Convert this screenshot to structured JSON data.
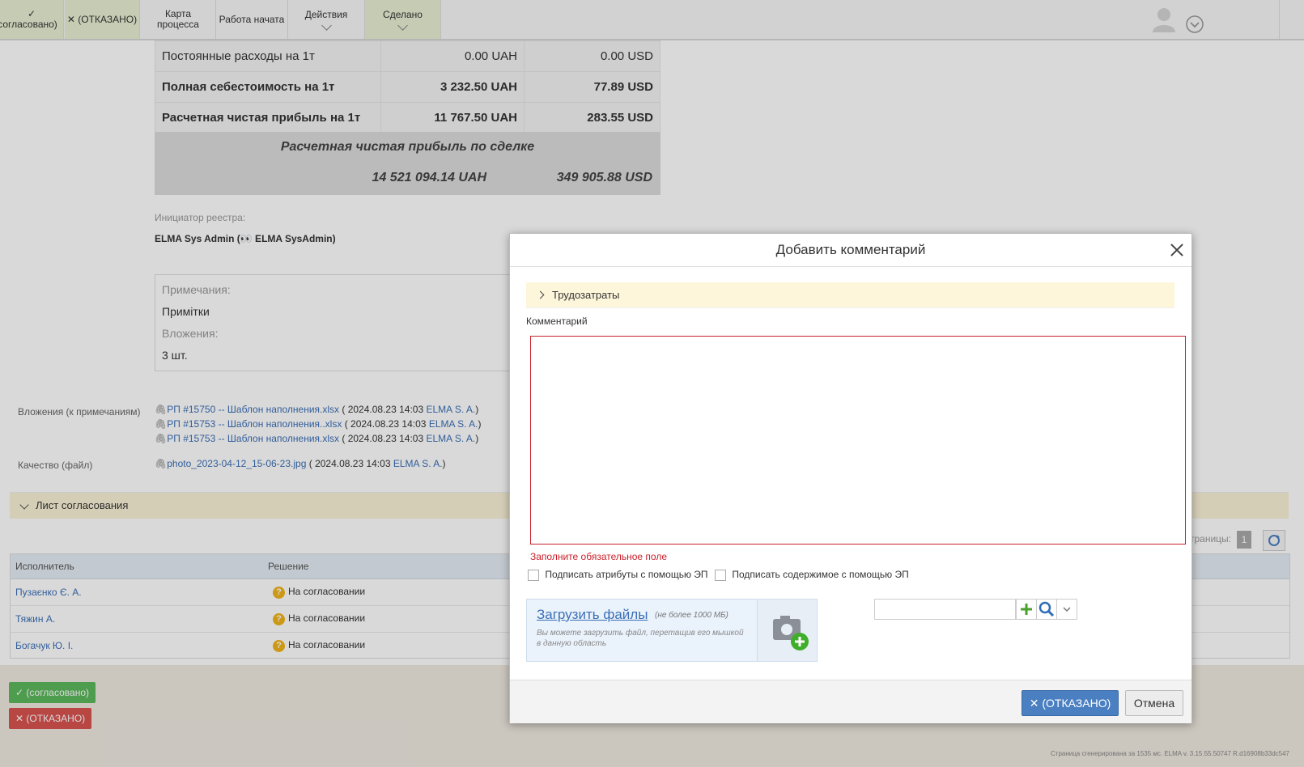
{
  "toolbar": {
    "approved": "✓\n(согласовано)",
    "approved_mark": "✓",
    "approved_label": "(согласовано)",
    "refused_label": "✕ (ОТКАЗАНО)",
    "process_map_line1": "Карта",
    "process_map_line2": "процесса",
    "work_started": "Работа начата",
    "actions": "Действия",
    "done": "Сделано"
  },
  "finance": {
    "rows": [
      {
        "label": "Постоянные расходы на 1т",
        "uah": "0.00 UAH",
        "usd": "0.00 USD"
      },
      {
        "label": "Полная себестоимость на 1т",
        "uah": "3 232.50 UAH",
        "usd": "77.89 USD"
      },
      {
        "label": "Расчетная чистая прибыль на 1т",
        "uah": "11 767.50 UAH",
        "usd": "283.55 USD"
      }
    ],
    "deal_label": "Расчетная чистая прибыль по сделке",
    "deal_uah": "14 521 094.14 UAH",
    "deal_usd": "349 905.88 USD"
  },
  "initiator": {
    "label": "Инициатор реестра:",
    "value": "ELMA Sys Admin (👀 ELMA SysAdmin)"
  },
  "notes": {
    "notes_label": "Примечания:",
    "notes_value": "Примітки",
    "attachments_label": "Вложения:",
    "attachments_value": "3 шт."
  },
  "attachments": {
    "label": "Вложения (к примечаниям)",
    "files": [
      {
        "name": "РП #15750 -- Шаблон наполнения.xlsx",
        "date": "( 2024.08.23 14:03",
        "author": "ELMA S. A.",
        "close": ")"
      },
      {
        "name": "РП #15753 -- Шаблон наполнения..xlsx",
        "date": "( 2024.08.23 14:03",
        "author": "ELMA S. A.",
        "close": ")"
      },
      {
        "name": "РП #15753 -- Шаблон наполнения.xlsx",
        "date": "( 2024.08.23 14:03",
        "author": "ELMA S. A.",
        "close": ")"
      }
    ]
  },
  "quality": {
    "label": "Качество (файл)",
    "name": "photo_2023-04-12_15-06-23.jpg",
    "date": "( 2024.08.23 14:03",
    "author": "ELMA S. A.",
    "close": ")"
  },
  "approval_sheet": {
    "title": "Лист согласования",
    "pages_label": "траницы:",
    "page": "1",
    "col_executor": "Исполнитель",
    "col_decision": "Решение",
    "rows": [
      {
        "executor": "Пузаєнко Є. А.",
        "decision": "На согласовании"
      },
      {
        "executor": "Тяжин А.",
        "decision": "На согласовании"
      },
      {
        "executor": "Богачук Ю. І.",
        "decision": "На согласовании"
      }
    ]
  },
  "page_buttons": {
    "approved": "✓ (согласовано)",
    "refused": "✕ (ОТКАЗАНО)"
  },
  "modal": {
    "title": "Добавить комментарий",
    "labor": "Трудозатраты",
    "comment_label": "Комментарий",
    "comment_value": "",
    "error": "Заполните обязательное поле",
    "sign_attrs": "Подписать атрибуты с помощью ЭП",
    "sign_content": "Подписать содержимое с помощью ЭП",
    "upload_link": "Загрузить файлы",
    "upload_limit": "(не более 1000 МБ)",
    "upload_hint": "Вы можете загрузить файл, перетащив его мышкой в данную область",
    "picker_value": "",
    "refuse_button": "✕ (ОТКАЗАНО)",
    "cancel_button": "Отмена"
  },
  "footer": {
    "generated": "Страница сгенерирована за 1535 мс. ELMA v. 3.15.55.50747 R.d16908b33dc547"
  }
}
